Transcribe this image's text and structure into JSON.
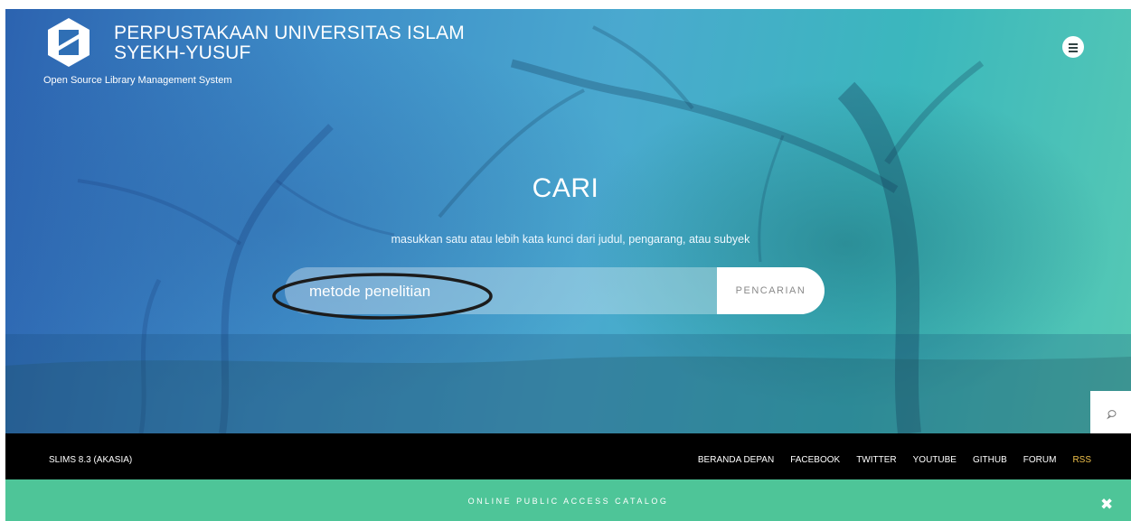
{
  "header": {
    "title_line1": "PERPUSTAKAAN UNIVERSITAS ISLAM",
    "title_line2": "SYEKH-YUSUF",
    "subtitle": "Open Source Library Management System",
    "menu_icon": "hamburger-menu-icon"
  },
  "search": {
    "heading": "CARI",
    "hint": "masukkan satu atau lebih kata kunci dari judul, pengarang, atau subyek",
    "input_value": "metode penelitian",
    "button_label": "PENCARIAN"
  },
  "chat": {
    "icon": "chat-bubble-icon"
  },
  "footer": {
    "version": "SLIMS 8.3 (AKASIA)",
    "links": [
      "BERANDA DEPAN",
      "FACEBOOK",
      "TWITTER",
      "YOUTUBE",
      "GITHUB",
      "FORUM",
      "RSS"
    ]
  },
  "opac": {
    "title": "ONLINE PUBLIC ACCESS CATALOG",
    "close_icon": "close-x-icon"
  },
  "colors": {
    "opac_bar": "#4ec598",
    "footer_bg": "#000000",
    "rss_link": "#f0c14b",
    "hero_left": "#2c63b0",
    "hero_right": "#56c9b4"
  }
}
